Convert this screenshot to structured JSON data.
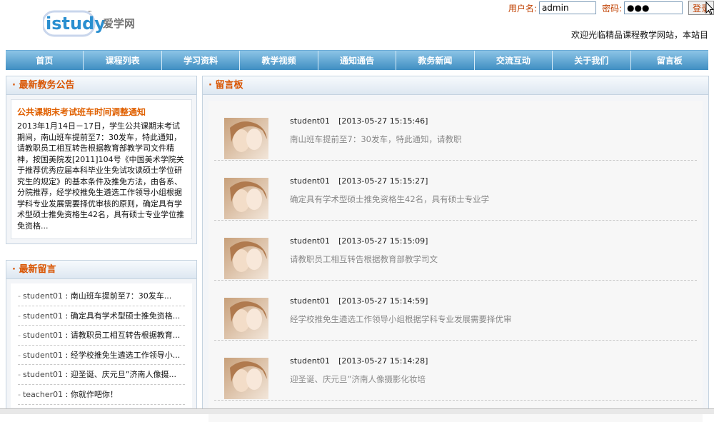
{
  "brand": {
    "logo_text": "istudy",
    "tm": "™",
    "cn_name": "爱学网"
  },
  "login": {
    "user_label": "用户名:",
    "user_value": "admin",
    "pwd_label": "密码:",
    "pwd_value": "●●●",
    "button_label": "登录"
  },
  "welcome": "欢迎光临精品课程教学网站，本站目",
  "nav": [
    "首页",
    "课程列表",
    "学习资料",
    "教学视频",
    "通知通告",
    "教务新闻",
    "交流互动",
    "关于我们",
    "留言板"
  ],
  "notice": {
    "header": "最新教务公告",
    "title": "公共课期末考试班车时间调整通知",
    "body": "2013年1月14日－17日，学生公共课期末考试期间，南山班车提前至7：30发车，特此通知，请教职员工相互转告根据教育部教学司文件精神，按国美院发[2011]104号《中国美术学院关于推荐优秀应届本科毕业生免试攻读硕士学位研究生的规定》的基本条件及推免方法，由各系、分院推荐，经学校推免生遴选工作领导小组根据学科专业发展需要择优审核的原则，确定具有学术型硕士推免资格生42名，具有硕士专业学位推免资格..."
  },
  "latest_msgs": {
    "header": "最新留言",
    "items": [
      {
        "user": "student01",
        "text": "南山班车提前至7：30发车..."
      },
      {
        "user": "student01",
        "text": "确定具有学术型硕士推免资格..."
      },
      {
        "user": "student01",
        "text": "请教职员工相互转告根据教育..."
      },
      {
        "user": "student01",
        "text": "经学校推免生遴选工作领导小..."
      },
      {
        "user": "student01",
        "text": "迎圣诞、庆元旦”济南人像摄..."
      },
      {
        "user": "teacher01",
        "text": "你就作吧你！"
      }
    ]
  },
  "board": {
    "header": "留言板",
    "entries": [
      {
        "user": "student01",
        "time": "[2013-05-27 15:15:46]",
        "text": "南山班车提前至7：30发车，特此通知，请教职"
      },
      {
        "user": "student01",
        "time": "[2013-05-27 15:15:27]",
        "text": "确定具有学术型硕士推免资格生42名，具有硕士专业学"
      },
      {
        "user": "student01",
        "time": "[2013-05-27 15:15:09]",
        "text": "请教职员工相互转告根据教育部教学司文"
      },
      {
        "user": "student01",
        "time": "[2013-05-27 15:14:59]",
        "text": "经学校推免生遴选工作领导小组根据学科专业发展需要择优审"
      },
      {
        "user": "student01",
        "time": "[2013-05-27 15:14:28]",
        "text": "迎圣诞、庆元旦”济南人像摄影化妆培"
      }
    ]
  }
}
